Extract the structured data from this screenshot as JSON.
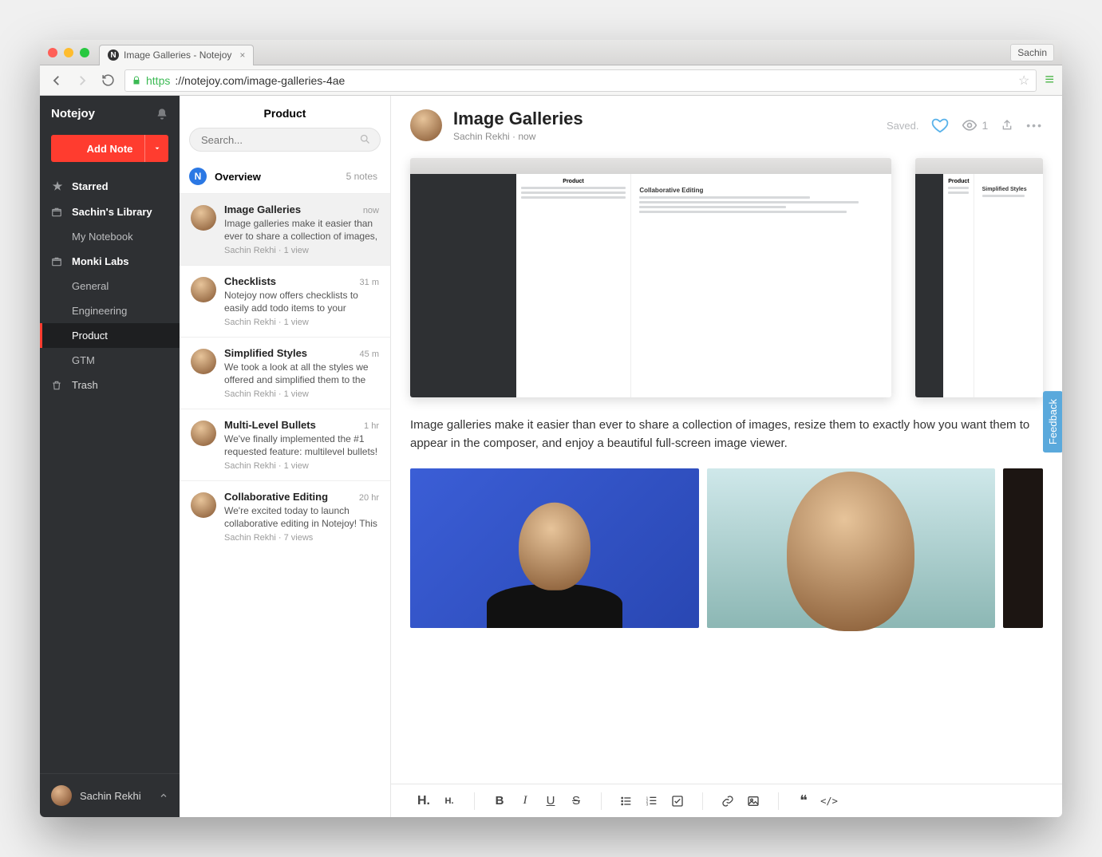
{
  "browser": {
    "tab_title": "Image Galleries - Notejoy",
    "profile": "Sachin",
    "url_https": "https",
    "url_rest": "://notejoy.com/image-galleries-4ae"
  },
  "sidebar": {
    "brand": "Notejoy",
    "add_label": "Add Note",
    "starred": "Starred",
    "lib1": "Sachin's Library",
    "lib1_items": {
      "0": "My Notebook"
    },
    "lib2": "Monki Labs",
    "lib2_items": {
      "0": "General",
      "1": "Engineering",
      "2": "Product",
      "3": "GTM"
    },
    "trash": "Trash",
    "footer_user": "Sachin Rekhi"
  },
  "list": {
    "heading": "Product",
    "search_placeholder": "Search...",
    "category_letter": "N",
    "category_title": "Overview",
    "category_count": "5 notes",
    "items": [
      {
        "title": "Image Galleries",
        "time": "now",
        "preview": "Image galleries make it easier than ever to share a collection of images,",
        "meta": "Sachin Rekhi · 1 view"
      },
      {
        "title": "Checklists",
        "time": "31 m",
        "preview": "Notejoy now offers checklists to easily add todo items to your existing not",
        "meta": "Sachin Rekhi · 1 view"
      },
      {
        "title": "Simplified Styles",
        "time": "45 m",
        "preview": "We took a look at all the styles we offered and simplified them to the most",
        "meta": "Sachin Rekhi · 1 view"
      },
      {
        "title": "Multi-Level Bullets",
        "time": "1 hr",
        "preview": "We've finally implemented the #1 requested feature: multilevel bullets! You",
        "meta": "Sachin Rekhi · 1 view"
      },
      {
        "title": "Collaborative Editing",
        "time": "20 hr",
        "preview": "We're excited today to launch collaborative editing in Notejoy! This",
        "meta": "Sachin Rekhi · 7 views"
      }
    ]
  },
  "note": {
    "title": "Image Galleries",
    "subtitle": "Sachin Rekhi · now",
    "saved": "Saved.",
    "view_count": "1",
    "body": "Image galleries make it easier than ever to share a collection of images, resize them to exactly how you want them to appear in the composer, and enjoy a beautiful full-screen image viewer."
  },
  "feedback_label": "Feedback",
  "toolbar": {
    "h1": "H.",
    "h2": "H.",
    "bold": "B",
    "italic": "I",
    "underline": "U",
    "strike": "S",
    "ul": "≡",
    "ol": "≡",
    "check": "☑",
    "link": "🔗",
    "image": "▣",
    "quote": "❝",
    "code": "</>"
  },
  "mini": {
    "collab_title": "Collaborative Editing",
    "styles_title": "Simplified Styles",
    "product_label": "Product"
  }
}
